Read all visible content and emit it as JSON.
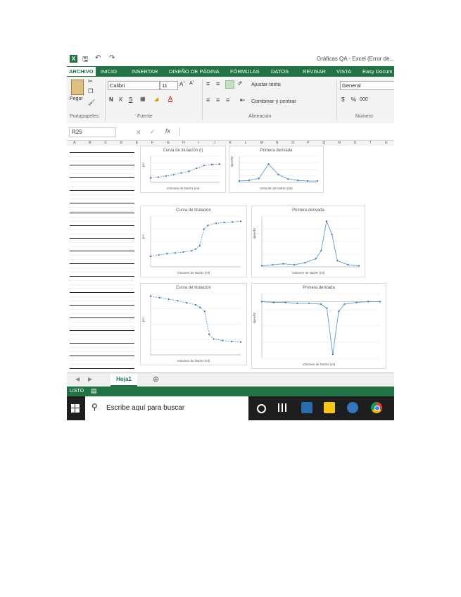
{
  "window": {
    "title": "Gráficas QA - Excel (Error de..."
  },
  "ribbon_tabs": [
    {
      "label": "ARCHIVO",
      "active": true
    },
    {
      "label": "INICIO"
    },
    {
      "label": "INSERTAR"
    },
    {
      "label": "DISEÑO DE PÁGINA"
    },
    {
      "label": "FÓRMULAS"
    },
    {
      "label": "DATOS"
    },
    {
      "label": "REVISAR"
    },
    {
      "label": "VISTA"
    },
    {
      "label": "Easy Docum"
    }
  ],
  "ribbon": {
    "paste_label": "Pegar",
    "clipboard_group": "Portapapeles",
    "font_name": "Calibri",
    "font_size": "11",
    "font_group": "Fuente",
    "wrap_text": "Ajustar texto",
    "merge_center": "Combinar y centrar",
    "alignment_group": "Alineación",
    "number_format": "General",
    "number_group": "Número",
    "bold": "N",
    "italic": "K",
    "underline": "S",
    "percent": "%",
    "thousands": "000"
  },
  "formula_bar": {
    "name_box": "R25",
    "fx": "fx"
  },
  "columns": [
    "A",
    "B",
    "C",
    "D",
    "E",
    "F",
    "G",
    "H",
    "I",
    "J",
    "K",
    "L",
    "M",
    "N",
    "O",
    "P",
    "Q",
    "R",
    "S",
    "T",
    "U"
  ],
  "charts": [
    {
      "title": "Curva de titulación (I)",
      "xlabel": "Volumen de NaOH (ml)",
      "ylabel": "pH",
      "chart_data": {
        "type": "scatter",
        "x": [
          0,
          1,
          2,
          3,
          4,
          5,
          6,
          7,
          8,
          9
        ],
        "y": [
          2.1,
          2.4,
          2.9,
          3.6,
          4.3,
          5.1,
          6.5,
          7.8,
          8.2,
          8.4
        ],
        "xlim": [
          0,
          9
        ],
        "ylim": [
          0,
          12
        ]
      }
    },
    {
      "title": "Primera derivada",
      "xlabel": "Volumen de NaOH (ml)",
      "ylabel": "dpH/dV",
      "chart_data": {
        "type": "line",
        "x": [
          0,
          1,
          2,
          3,
          4,
          5,
          6,
          7,
          8
        ],
        "y": [
          0.2,
          0.3,
          0.6,
          2.8,
          1.2,
          0.5,
          0.3,
          0.2,
          0.2
        ],
        "xlim": [
          0,
          8
        ],
        "ylim": [
          0,
          4
        ]
      }
    },
    {
      "title": "Curva de titulación",
      "xlabel": "Volumen de NaOH (ml)",
      "ylabel": "pH",
      "chart_data": {
        "type": "scatter",
        "x": [
          0,
          2,
          4,
          6,
          8,
          10,
          11,
          12,
          13,
          14,
          16,
          18,
          20,
          22
        ],
        "y": [
          2.5,
          2.8,
          3.1,
          3.3,
          3.5,
          3.8,
          4.2,
          5.0,
          8.9,
          9.8,
          10.3,
          10.5,
          10.6,
          10.8
        ],
        "xlim": [
          0,
          22
        ],
        "ylim": [
          0,
          12
        ]
      }
    },
    {
      "title": "Primera derivada",
      "xlabel": "Volumen de NaOH (ml)",
      "ylabel": "dpH/dV",
      "chart_data": {
        "type": "line",
        "x": [
          0,
          2,
          4,
          6,
          8,
          10,
          11,
          12,
          13,
          14,
          16,
          18
        ],
        "y": [
          0.1,
          0.2,
          0.3,
          0.2,
          0.4,
          0.8,
          1.6,
          4.5,
          3.2,
          0.6,
          0.2,
          0.1
        ],
        "xlim": [
          0,
          18
        ],
        "ylim": [
          0,
          5
        ]
      }
    },
    {
      "title": "Curva de titulación",
      "xlabel": "Volumen de NaOH (ml)",
      "ylabel": "pH",
      "chart_data": {
        "type": "scatter",
        "x": [
          0,
          2,
          4,
          6,
          8,
          10,
          11,
          12,
          13,
          14,
          16,
          18,
          20
        ],
        "y": [
          11.5,
          11.2,
          10.9,
          10.6,
          10.2,
          9.8,
          9.3,
          8.5,
          4.0,
          3.1,
          2.8,
          2.6,
          2.5
        ],
        "xlim": [
          0,
          20
        ],
        "ylim": [
          0,
          12
        ]
      }
    },
    {
      "title": "Primera derivada",
      "xlabel": "Volumen de NaOH (ml)",
      "ylabel": "dpH/dV",
      "chart_data": {
        "type": "line",
        "x": [
          0,
          2,
          4,
          6,
          8,
          10,
          11,
          12,
          13,
          14,
          16,
          18,
          20
        ],
        "y": [
          0.0,
          -0.1,
          -0.1,
          -0.2,
          -0.2,
          -0.3,
          -0.8,
          -6.5,
          -1.2,
          -0.3,
          -0.1,
          0.0,
          0.0
        ],
        "xlim": [
          0,
          20
        ],
        "ylim": [
          -7,
          1
        ]
      }
    }
  ],
  "sheet": {
    "tab": "Hoja1"
  },
  "status": {
    "text": "LISTO"
  },
  "taskbar": {
    "search_placeholder": "Escribe aquí para buscar"
  }
}
